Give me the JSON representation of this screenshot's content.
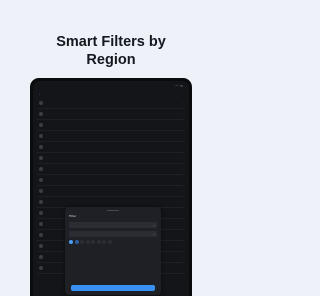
{
  "headline": {
    "line1": "Smart Filters by",
    "line2": "Region"
  },
  "colors": {
    "background": "#eef1f7",
    "accent": "#3a8ff2",
    "screen": "#141519"
  },
  "status": {
    "time": "",
    "indicators": ""
  },
  "nav": {
    "back_label": ""
  },
  "list": {
    "rows": [
      {
        "title": "",
        "subtitle": ""
      },
      {
        "title": "",
        "subtitle": ""
      },
      {
        "title": "",
        "subtitle": ""
      },
      {
        "title": "",
        "subtitle": ""
      },
      {
        "title": "",
        "subtitle": ""
      },
      {
        "title": "",
        "subtitle": ""
      },
      {
        "title": "",
        "subtitle": ""
      },
      {
        "title": "",
        "subtitle": ""
      },
      {
        "title": "",
        "subtitle": ""
      },
      {
        "title": "",
        "subtitle": ""
      },
      {
        "title": "",
        "subtitle": ""
      },
      {
        "title": "",
        "subtitle": ""
      },
      {
        "title": "",
        "subtitle": ""
      },
      {
        "title": "",
        "subtitle": ""
      },
      {
        "title": "",
        "subtitle": ""
      },
      {
        "title": "",
        "subtitle": ""
      }
    ]
  },
  "filter_sheet": {
    "title": "Filter",
    "reset_label": "",
    "field1_label": "",
    "field1_value": "",
    "field2_label": "",
    "field2_value": "",
    "chips_label": "",
    "chips": [
      {
        "label": "",
        "active": true
      },
      {
        "label": "",
        "active": false
      },
      {
        "label": "",
        "active": false
      },
      {
        "label": "",
        "active": false
      },
      {
        "label": "",
        "active": false
      },
      {
        "label": "",
        "active": false
      },
      {
        "label": "",
        "active": false
      }
    ],
    "apply_label": ""
  }
}
